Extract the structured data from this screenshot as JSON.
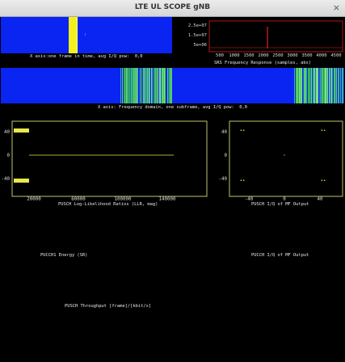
{
  "window": {
    "title": "LTE UL SCOPE gNB",
    "close_glyph": "×"
  },
  "time_panel": {
    "label": "X axis:one frame in time, avg I/Q pow:  0,0"
  },
  "srs_panel": {
    "label": "SRS Frequency Response (samples, abs)",
    "yticks": [
      "2.5e+07",
      "1.5e+07",
      "5e+06"
    ],
    "xticks": [
      "500",
      "1000",
      "1500",
      "2000",
      "2500",
      "3000",
      "3500",
      "4000",
      "4500"
    ]
  },
  "freq_panel": {
    "label": "X axis: Frequency domain, one subframe, avg I/Q pow:  0,0"
  },
  "llr_panel": {
    "label": "PUSCH Log-Likelihood Ratios (LLR, mag)",
    "yticks": [
      "40",
      "0",
      "-40"
    ],
    "xticks": [
      "20000",
      "60000",
      "100000",
      "140000"
    ]
  },
  "iq_panel": {
    "label": "PUSCH I/Q of MF Output",
    "yticks": [
      "40",
      "0",
      "-40"
    ],
    "xticks": [
      "-40",
      "0",
      "40"
    ]
  },
  "pucch_energy": {
    "label": "PUCCH1 Energy (SR)"
  },
  "pucch_iq": {
    "label": "PUCCH I/Q of MF Output"
  },
  "throughput": {
    "label": "PUSCH Throughput [frame]/[kbit/s]"
  },
  "colors": {
    "background": "#000000",
    "spectrum_blue": "#0a24f2",
    "time_marker": "#f4f01c",
    "stripe_green": "#39c25a",
    "srs_axis": "#b01616",
    "plot_axis": "#c2c468",
    "data_yellow": "#e7e84b"
  }
}
